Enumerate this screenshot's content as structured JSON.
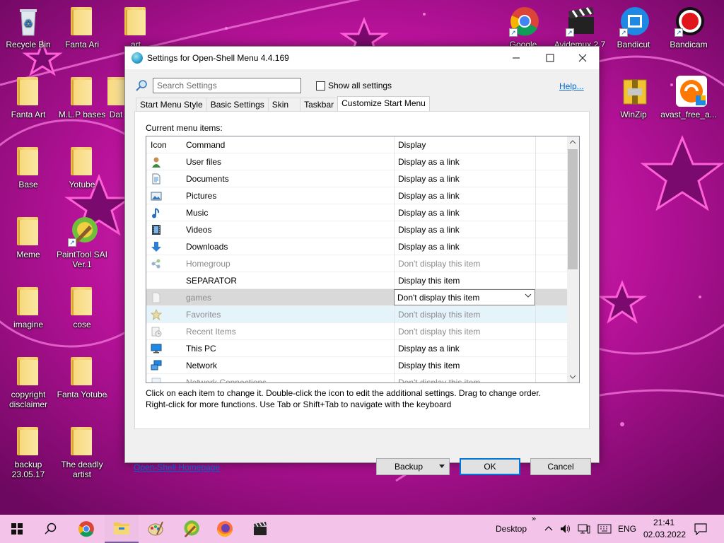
{
  "desktop": {
    "icons_left": [
      {
        "label": "Recycle Bin",
        "kind": "recycle"
      },
      {
        "label": "Fanta Ari",
        "kind": "folder"
      },
      {
        "label": "art",
        "kind": "folder"
      },
      {
        "label": "Fanta Art",
        "kind": "folder"
      },
      {
        "label": "M.L.P bases",
        "kind": "folder"
      },
      {
        "label": "Dat",
        "kind": "folder"
      },
      {
        "label": "Base",
        "kind": "folder"
      },
      {
        "label": "Yotube",
        "kind": "folder"
      },
      {
        "label": "Meme",
        "kind": "folder"
      },
      {
        "label": "PaintTool SAI Ver.1",
        "kind": "app"
      },
      {
        "label": "imagine",
        "kind": "folder"
      },
      {
        "label": "cose",
        "kind": "folder"
      },
      {
        "label": "copyright disclaimer",
        "kind": "folder"
      },
      {
        "label": "Fanta Yotube",
        "kind": "folder"
      },
      {
        "label": "backup 23.05.17",
        "kind": "folder"
      },
      {
        "label": "The deadly artist",
        "kind": "folder"
      }
    ],
    "icons_right": [
      {
        "label": "Google",
        "kind": "chrome"
      },
      {
        "label": "Avidemux 2.7",
        "kind": "clapper"
      },
      {
        "label": "Bandicut",
        "kind": "bandicut"
      },
      {
        "label": "Bandicam",
        "kind": "bandicam"
      },
      {
        "label": "WinZip",
        "kind": "winzip"
      },
      {
        "label": "avast_free_a...",
        "kind": "avast"
      }
    ]
  },
  "window": {
    "title": "Settings for Open-Shell Menu 4.4.169",
    "search_placeholder": "Search Settings",
    "show_all_label": "Show all settings",
    "help_label": "Help...",
    "tabs": [
      {
        "label": "Start Menu Style",
        "active": false
      },
      {
        "label": "Basic Settings",
        "active": false
      },
      {
        "label": "Skin",
        "active": false
      },
      {
        "label": "Taskbar",
        "active": false
      },
      {
        "label": "Customize Start Menu",
        "active": true
      }
    ],
    "current_items_label": "Current menu items:",
    "columns": {
      "icon": "Icon",
      "command": "Command",
      "display": "Display"
    },
    "rows": [
      {
        "command": "User files",
        "display": "Display as a link",
        "icon": "user-icon",
        "dim": false
      },
      {
        "command": "Documents",
        "display": "Display as a link",
        "icon": "document-icon",
        "dim": false
      },
      {
        "command": "Pictures",
        "display": "Display as a link",
        "icon": "pictures-icon",
        "dim": false
      },
      {
        "command": "Music",
        "display": "Display as a link",
        "icon": "music-icon",
        "dim": false
      },
      {
        "command": "Videos",
        "display": "Display as a link",
        "icon": "videos-icon",
        "dim": false
      },
      {
        "command": "Downloads",
        "display": "Display as a link",
        "icon": "downloads-icon",
        "dim": false
      },
      {
        "command": "Homegroup",
        "display": "Don't display this item",
        "icon": "homegroup-icon",
        "dim": true
      },
      {
        "command": "SEPARATOR",
        "display": "Display this item",
        "icon": "",
        "dim": false
      },
      {
        "command": "games",
        "display": "Don't display this item",
        "icon": "blank-page-icon",
        "dim": true,
        "selected": true
      },
      {
        "command": "Favorites",
        "display": "Don't display this item",
        "icon": "star-icon",
        "dim": true,
        "hover": true
      },
      {
        "command": "Recent Items",
        "display": "Don't display this item",
        "icon": "recent-icon",
        "dim": true
      },
      {
        "command": "This PC",
        "display": "Display as a link",
        "icon": "computer-icon",
        "dim": false
      },
      {
        "command": "Network",
        "display": "Display this item",
        "icon": "network-icon",
        "dim": false
      },
      {
        "command": "Network Connections",
        "display": "Don't display this item",
        "icon": "network-connections-icon",
        "dim": true
      }
    ],
    "hint_line1": "Click on each item to change it. Double-click the icon to edit the additional settings. Drag to change order.",
    "hint_line2": "Right-click for more functions. Use Tab or Shift+Tab to navigate with the keyboard",
    "homepage_label": "Open-Shell Homepage",
    "backup_label": "Backup",
    "ok_label": "OK",
    "cancel_label": "Cancel"
  },
  "taskbar": {
    "desktop_label": "Desktop",
    "language": "ENG",
    "time": "21:41",
    "date": "02.03.2022"
  },
  "colors": {
    "wallpaper": "#b1108f",
    "taskbar": "#f3c3ea",
    "accent": "#0078d7",
    "link": "#0066cc"
  }
}
